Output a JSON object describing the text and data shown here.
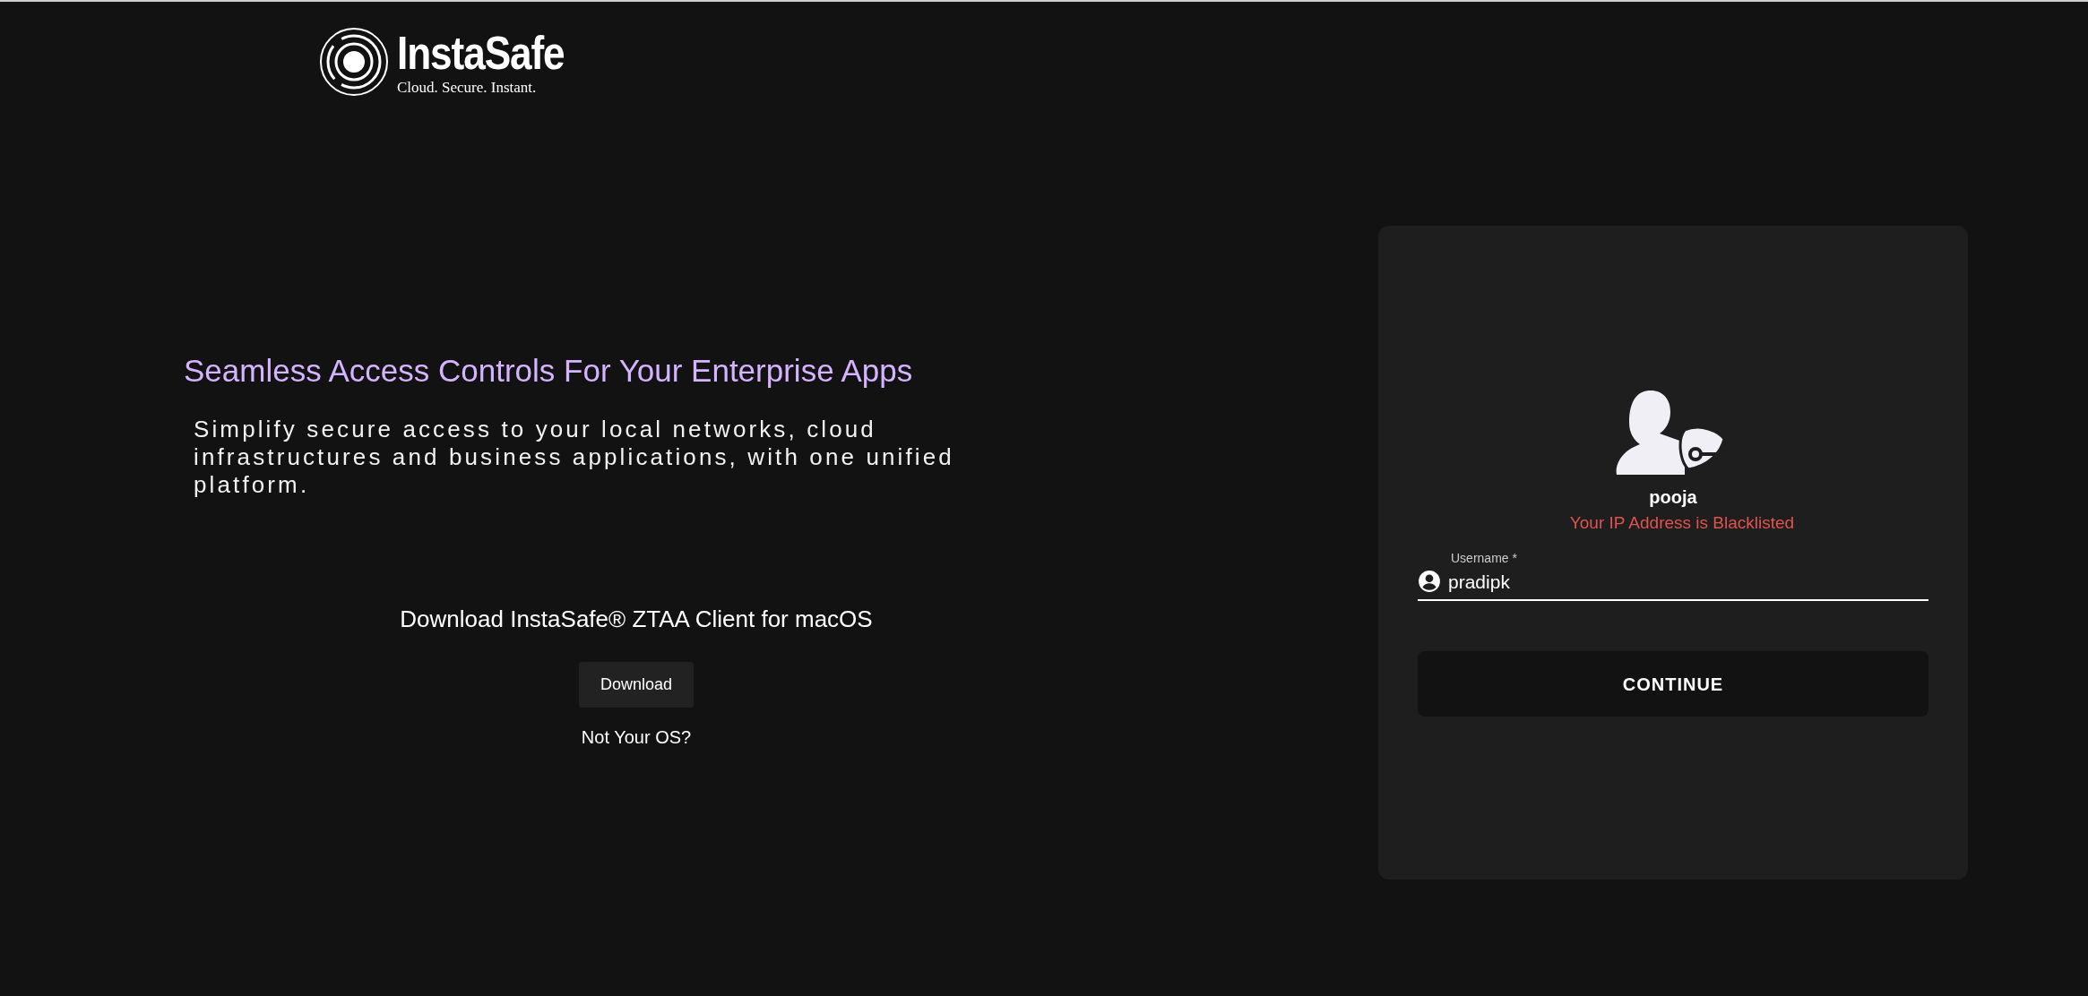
{
  "logo": {
    "name": "InstaSafe",
    "tagline": "Cloud. Secure. Instant."
  },
  "hero": {
    "heading": "Seamless Access Controls For Your Enterprise Apps",
    "text": "Simplify secure access to your local networks, cloud infrastructures and business applications, with one unified platform."
  },
  "download": {
    "title": "Download InstaSafe® ZTAA Client for macOS",
    "button": "Download",
    "link": "Not Your OS?"
  },
  "login": {
    "user": "pooja",
    "error": "Your IP Address is Blacklisted",
    "field": {
      "label": "Username *",
      "value": "pradipk"
    },
    "button": "CONTINUE"
  }
}
